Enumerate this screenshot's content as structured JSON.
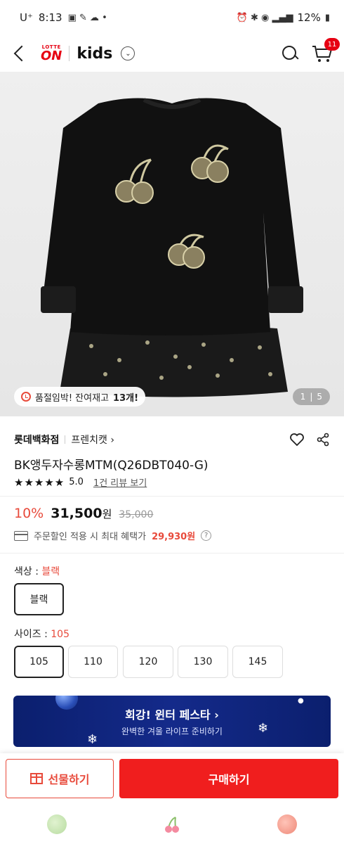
{
  "status_bar": {
    "carrier": "U⁺",
    "time": "8:13",
    "battery": "12%"
  },
  "header": {
    "logo_top": "LOTTE",
    "logo_main": "ON",
    "section": "kids",
    "cart_count": "11"
  },
  "hero": {
    "alert_prefix": "품절임박! 잔여재고 ",
    "alert_count": "13개!",
    "pager_current": "1",
    "pager_total": "5"
  },
  "product": {
    "brand": "롯데백화점",
    "store": "프렌치캣 ›",
    "title": "BK앵두자수롱MTM(Q26DBT040-G)",
    "stars": "★★★★★",
    "rating": "5.0",
    "review_link": "1건 리뷰 보기"
  },
  "price": {
    "discount": "10%",
    "price": "31,500",
    "currency": "원",
    "original": "35,000"
  },
  "benefit": {
    "text": "주문할인 적용 시 최대 혜택가",
    "amount": "29,930원",
    "help": "?"
  },
  "options": {
    "color_label": "색상 : ",
    "color_value": "블랙",
    "colors": [
      "블랙"
    ],
    "size_label": "사이즈 : ",
    "size_value": "105",
    "sizes": [
      "105",
      "110",
      "120",
      "130",
      "145"
    ]
  },
  "banner": {
    "title": "회강! 윈터 페스타  ›",
    "subtitle": "완벽한 겨울 라이프 준비하기"
  },
  "actions": {
    "gift": "선물하기",
    "buy": "구매하기"
  },
  "colors": {
    "accent": "#e84a3b",
    "buy_button": "#f01e1e",
    "banner_bg": "#142a8a"
  }
}
